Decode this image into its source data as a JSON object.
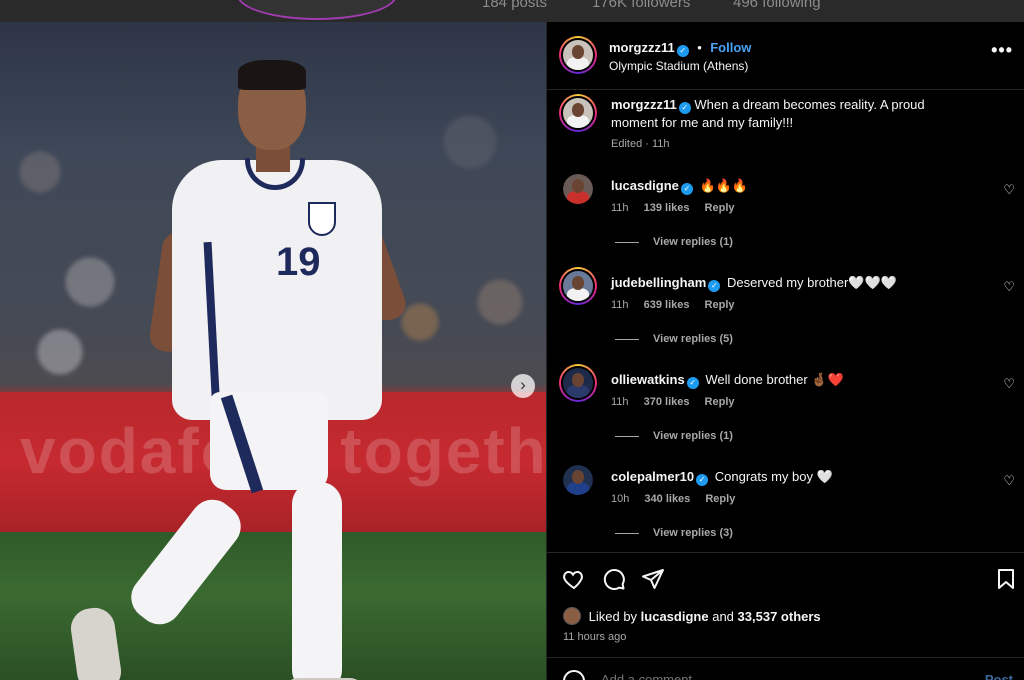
{
  "profile_bg": {
    "posts": "184 posts",
    "followers": "176K followers",
    "following": "496 following"
  },
  "post": {
    "username": "morgzzz11",
    "follow_label": "Follow",
    "separator": "•",
    "location": "Olympic Stadium (Athens)",
    "more_label": "•••",
    "caption": "When a dream becomes reality. A proud moment for me and my family!!!",
    "caption_meta": "Edited · 11h",
    "jersey_number": "19",
    "board_text": "vodafone together"
  },
  "comments": [
    {
      "username": "lucasdigne",
      "text": "🔥🔥🔥",
      "time": "11h",
      "likes": "139 likes",
      "reply": "Reply",
      "view_replies": "View replies (1)"
    },
    {
      "username": "judebellingham",
      "text": "Deserved my brother🤍🤍🤍",
      "time": "11h",
      "likes": "639 likes",
      "reply": "Reply",
      "view_replies": "View replies (5)"
    },
    {
      "username": "olliewatkins",
      "text": "Well done brother 🤞🏾❤️",
      "time": "11h",
      "likes": "370 likes",
      "reply": "Reply",
      "view_replies": "View replies (1)"
    },
    {
      "username": "colepalmer10",
      "text": "Congrats my boy 🤍",
      "time": "10h",
      "likes": "340 likes",
      "reply": "Reply",
      "view_replies": "View replies (3)"
    }
  ],
  "footer": {
    "liked_by_prefix": "Liked by",
    "liked_by_user": "lucasdigne",
    "and": "and",
    "others": "33,537 others",
    "time_ago": "11 hours ago",
    "add_comment_placeholder": "Add a comment...",
    "post_label": "Post"
  },
  "icons": {
    "heart": "heart-icon",
    "comment": "comment-icon",
    "share": "share-icon",
    "bookmark": "bookmark-icon",
    "emoji": "emoji-icon",
    "verified": "verified-icon"
  },
  "colors": {
    "accent": "#4aa3f7",
    "verified": "#1d9bf0",
    "muted": "#a8a8a8"
  }
}
